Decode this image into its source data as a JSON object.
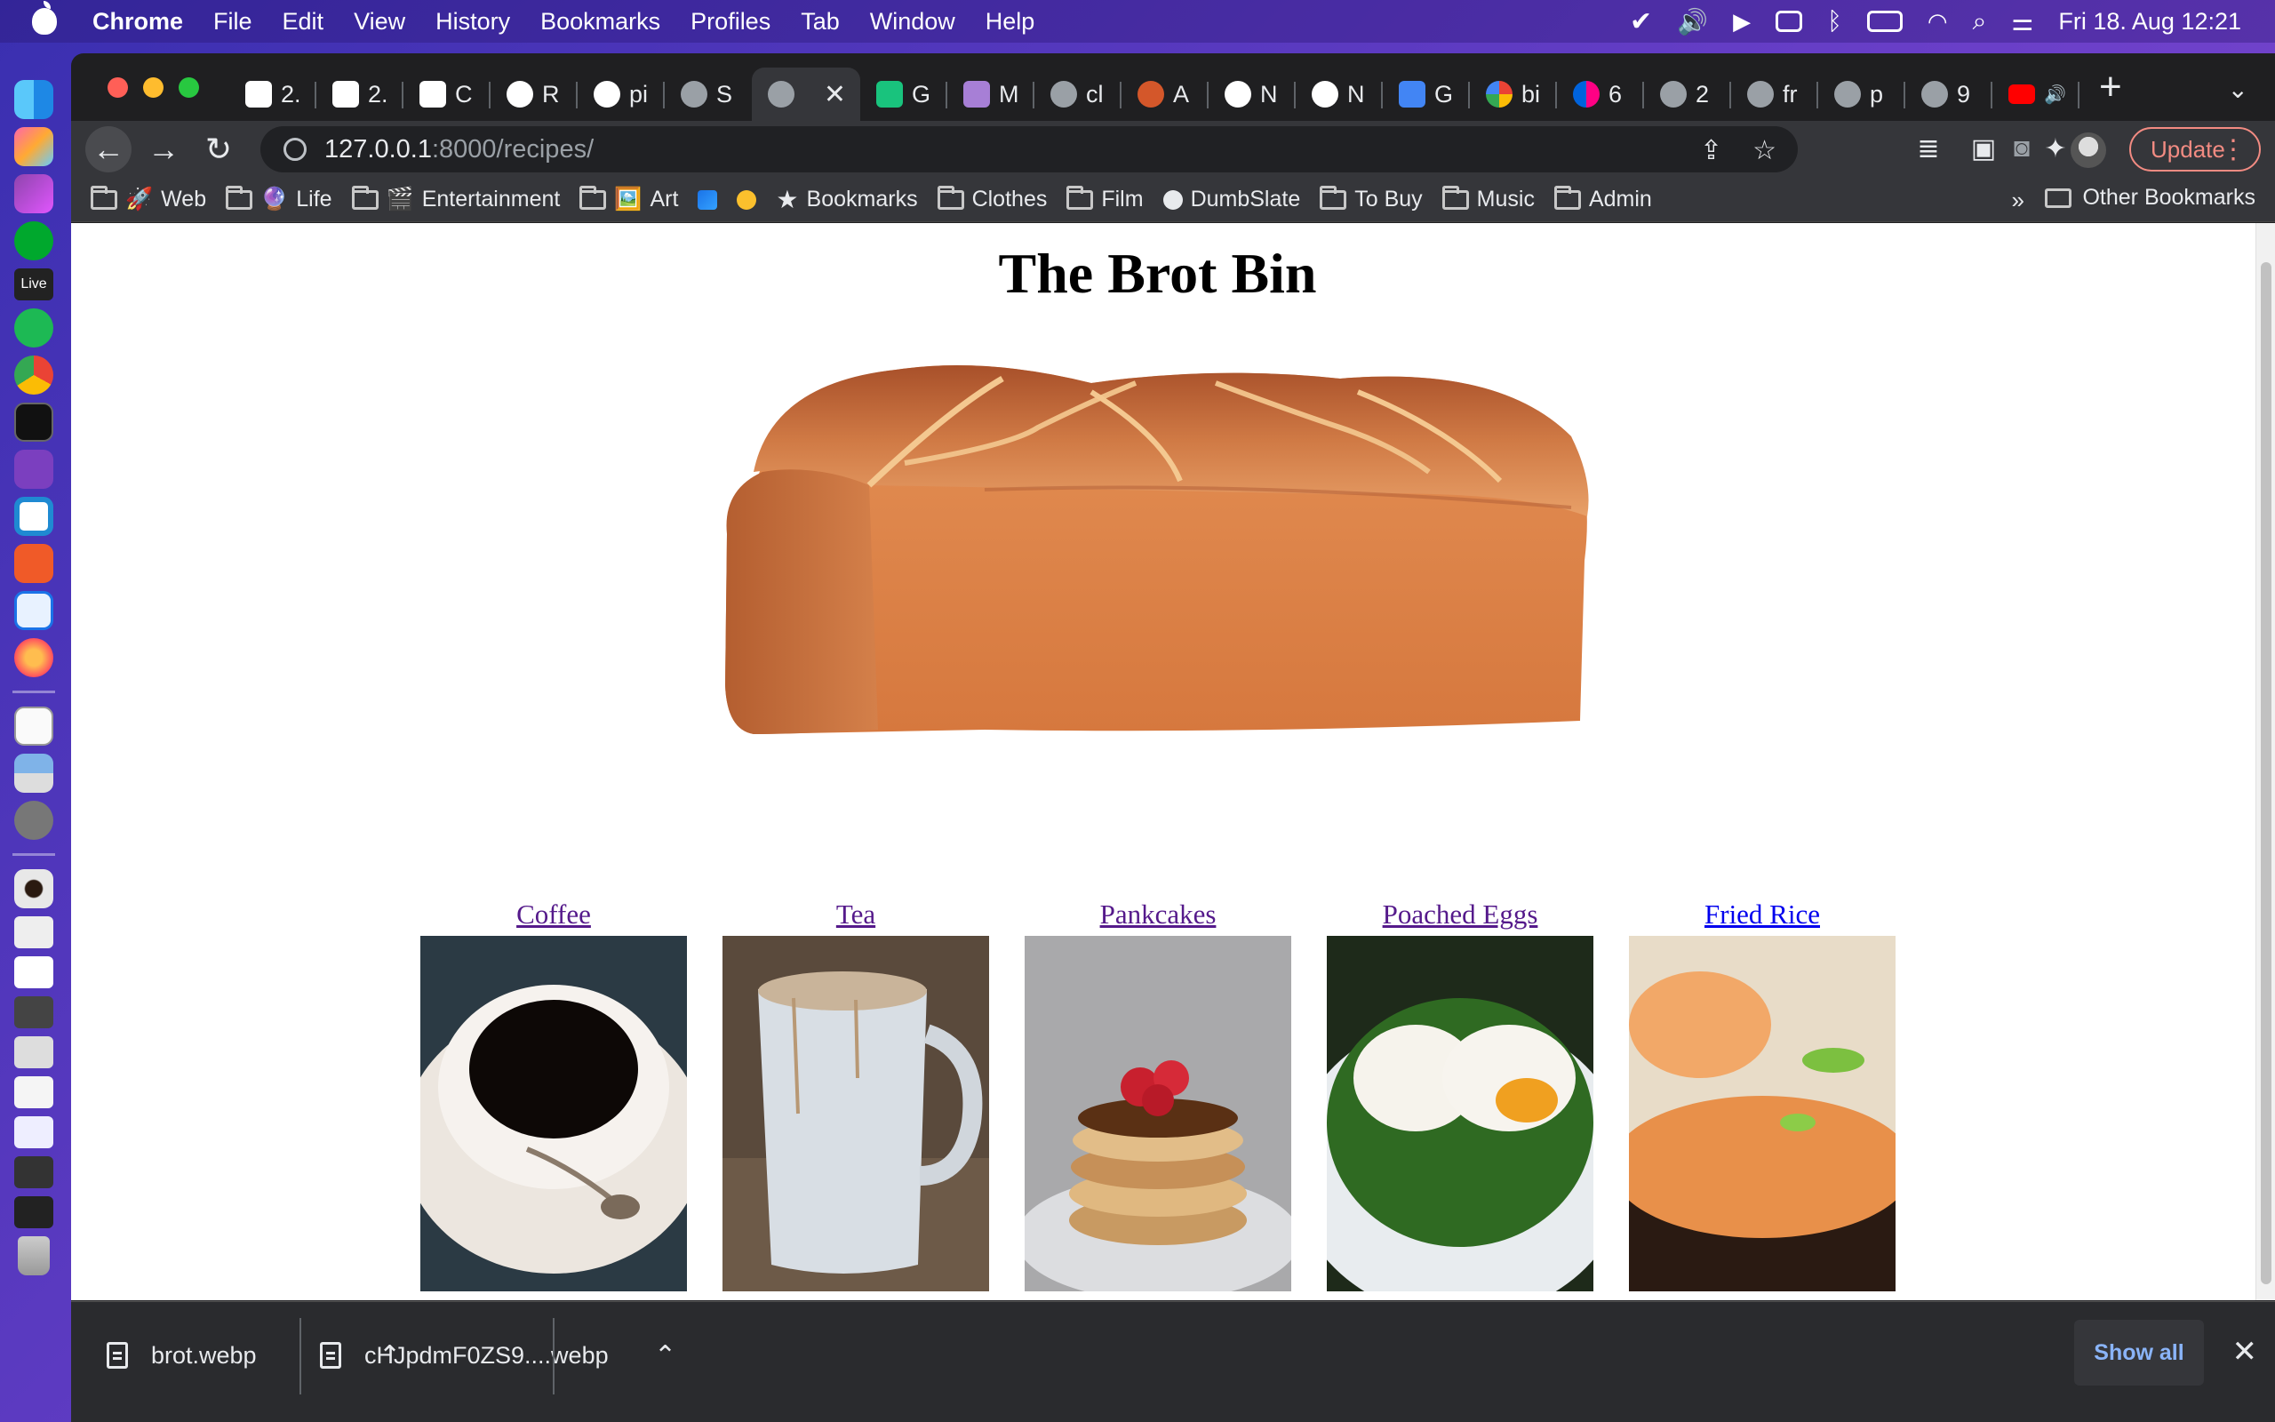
{
  "menubar": {
    "app_name": "Chrome",
    "items": [
      "File",
      "Edit",
      "View",
      "History",
      "Bookmarks",
      "Profiles",
      "Tab",
      "Window",
      "Help"
    ],
    "clock": "Fri 18. Aug  12:21"
  },
  "tabs": [
    {
      "label": "2.",
      "icon": "cf-icon"
    },
    {
      "label": "2.",
      "icon": "cf-icon"
    },
    {
      "label": "C",
      "icon": "cf-icon"
    },
    {
      "label": "R",
      "icon": "github-icon"
    },
    {
      "label": "pi",
      "icon": "github-icon"
    },
    {
      "label": "S",
      "icon": "globe-icon"
    },
    {
      "label": "",
      "icon": "globe-icon",
      "active": true
    },
    {
      "label": "G",
      "icon": "chatgpt-icon"
    },
    {
      "label": "M",
      "icon": "trello-icon"
    },
    {
      "label": "cl",
      "icon": "globe-icon"
    },
    {
      "label": "A",
      "icon": "asterisk-icon"
    },
    {
      "label": "N",
      "icon": "chrome-icon"
    },
    {
      "label": "N",
      "icon": "chrome-icon"
    },
    {
      "label": "G",
      "icon": "calendar-icon"
    },
    {
      "label": "bi",
      "icon": "google-icon"
    },
    {
      "label": "6",
      "icon": "flickr-icon"
    },
    {
      "label": "2",
      "icon": "globe-icon"
    },
    {
      "label": "fr",
      "icon": "globe-icon"
    },
    {
      "label": "p",
      "icon": "globe-icon"
    },
    {
      "label": "9",
      "icon": "globe-icon"
    },
    {
      "label": "",
      "icon": "youtube-icon"
    }
  ],
  "address": {
    "host": "127.0.0.1",
    "rest": ":8000/recipes/"
  },
  "toolbar": {
    "update_label": "Update"
  },
  "bookmarks": [
    {
      "label": "Web",
      "emoji": "🚀"
    },
    {
      "label": "Life",
      "emoji": "🔮"
    },
    {
      "label": "Entertainment",
      "emoji": "🎬"
    },
    {
      "label": "Art",
      "emoji": "🖼️"
    }
  ],
  "bookmarks_single": {
    "bookmarks_label": "Bookmarks",
    "clothes": "Clothes",
    "film": "Film",
    "dumbslate": "DumbSlate",
    "to_buy": "To Buy",
    "music": "Music",
    "admin": "Admin",
    "more": "»",
    "other": "Other Bookmarks"
  },
  "page": {
    "title": "The Brot Bin",
    "recipes": [
      {
        "name": "Coffee",
        "visited": true
      },
      {
        "name": "Tea",
        "visited": true
      },
      {
        "name": "Pankcakes",
        "visited": true
      },
      {
        "name": "Poached Eggs",
        "visited": true
      },
      {
        "name": "Fried Rice",
        "visited": false
      }
    ]
  },
  "downloads": {
    "items": [
      "brot.webp",
      "cHJpdmF0ZS9....webp"
    ],
    "show_all": "Show all"
  },
  "colors": {
    "link_visited": "#551a8b",
    "link_unvisited": "#0000ee",
    "update_accent": "#f28b82",
    "show_all": "#8ab4f8"
  }
}
